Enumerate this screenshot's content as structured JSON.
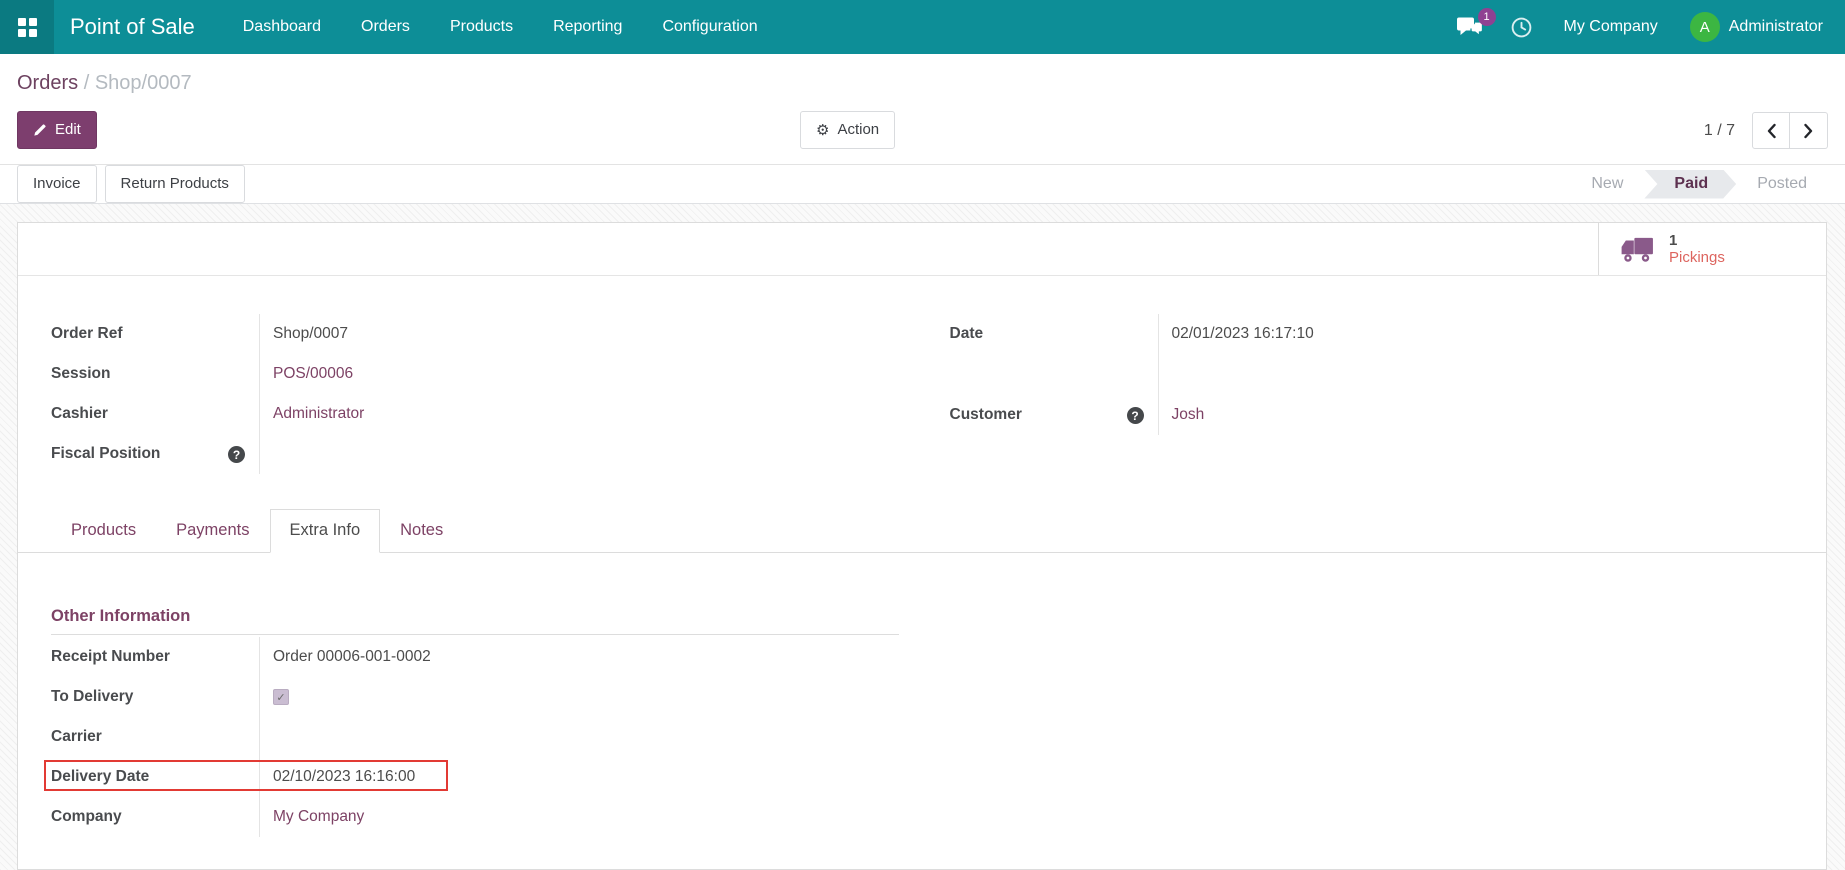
{
  "navbar": {
    "app": "Point of Sale",
    "menus": [
      "Dashboard",
      "Orders",
      "Products",
      "Reporting",
      "Configuration"
    ],
    "messages_badge": "1",
    "company": "My Company",
    "user": "Administrator",
    "avatar_letter": "A"
  },
  "breadcrumb": {
    "parent": "Orders",
    "sep": "/",
    "current": "Shop/0007"
  },
  "controls": {
    "edit": "Edit",
    "action": "Action",
    "pager": "1 / 7"
  },
  "header": {
    "buttons": [
      "Invoice",
      "Return Products"
    ],
    "statusbar": [
      "New",
      "Paid",
      "Posted"
    ],
    "active_state": "Paid"
  },
  "stat_button": {
    "value": "1",
    "label": "Pickings"
  },
  "form": {
    "left": [
      {
        "label": "Order Ref",
        "value": "Shop/0007",
        "type": "text"
      },
      {
        "label": "Session",
        "value": "POS/00006",
        "type": "link"
      },
      {
        "label": "Cashier",
        "value": "Administrator",
        "type": "link"
      },
      {
        "label": "Fiscal Position",
        "value": "",
        "type": "empty",
        "has_help": true
      }
    ],
    "right": [
      {
        "label": "Date",
        "value": "02/01/2023 16:17:10",
        "type": "text"
      },
      {
        "label": "Customer",
        "value": "Josh",
        "type": "link",
        "has_help": true
      }
    ]
  },
  "tabs": [
    {
      "label": "Products",
      "active": false
    },
    {
      "label": "Payments",
      "active": false
    },
    {
      "label": "Extra Info",
      "active": true
    },
    {
      "label": "Notes",
      "active": false
    }
  ],
  "extra_info": {
    "section_title": "Other Information",
    "rows": [
      {
        "label": "Receipt Number",
        "value": "Order 00006-001-0002",
        "type": "text"
      },
      {
        "label": "To Delivery",
        "type": "checkbox",
        "checked": true
      },
      {
        "label": "Carrier",
        "value": "",
        "type": "empty"
      },
      {
        "label": "Delivery Date",
        "value": "02/10/2023 16:16:00",
        "type": "text",
        "highlighted": true
      },
      {
        "label": "Company",
        "value": "My Company",
        "type": "link"
      }
    ]
  },
  "icons": {
    "help": "?",
    "gear": "⚙",
    "check": "✓"
  },
  "colors": {
    "navbar": "#0d8e97",
    "primary_button": "#7d3e6e",
    "link": "#7d4265",
    "active_state_text": "#5d3150",
    "stat_label": "#dd655f",
    "truck": "#8a5a8a",
    "highlight_border": "#e23a34",
    "avatar": "#3cb642",
    "badge": "#8f4192"
  }
}
